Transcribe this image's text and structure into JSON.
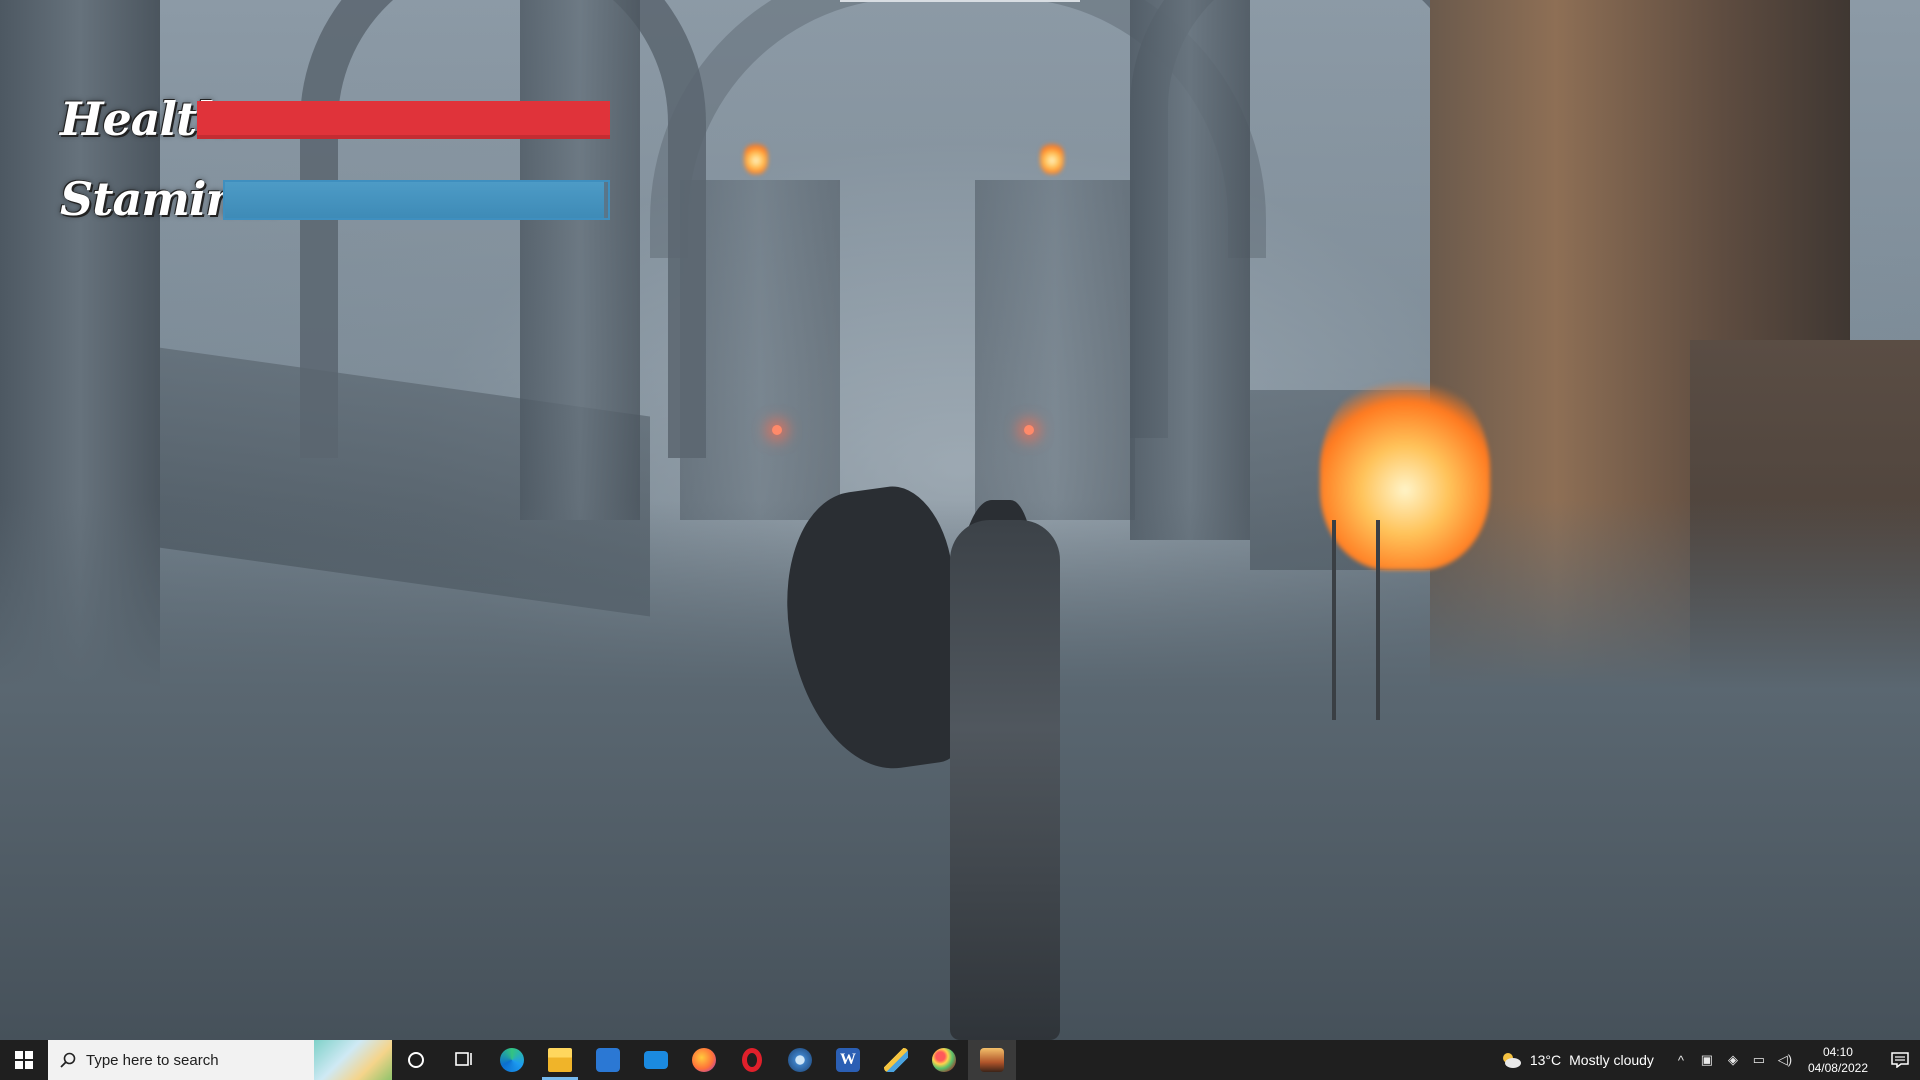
{
  "hud": {
    "health_label": "Health:",
    "health_value": 1.0,
    "stamina_label": "Stamina:",
    "stamina_value": 0.99
  },
  "taskbar": {
    "search_placeholder": "Type here to search",
    "apps": [
      {
        "name": "cortana-icon"
      },
      {
        "name": "task-view-icon"
      },
      {
        "name": "edge-icon"
      },
      {
        "name": "file-explorer-icon"
      },
      {
        "name": "store-icon"
      },
      {
        "name": "mail-icon"
      },
      {
        "name": "firefox-icon"
      },
      {
        "name": "opera-icon"
      },
      {
        "name": "steam-icon"
      },
      {
        "name": "word-icon"
      },
      {
        "name": "pen-app-icon"
      },
      {
        "name": "paint-app-icon"
      },
      {
        "name": "game-app-icon"
      }
    ],
    "weather_temp": "13°C",
    "weather_desc": "Mostly cloudy",
    "time": "04:10",
    "date": "04/08/2022"
  },
  "colors": {
    "health": "#e0333a",
    "stamina": "#4d9bc6",
    "taskbar": "#1f1f1f"
  }
}
